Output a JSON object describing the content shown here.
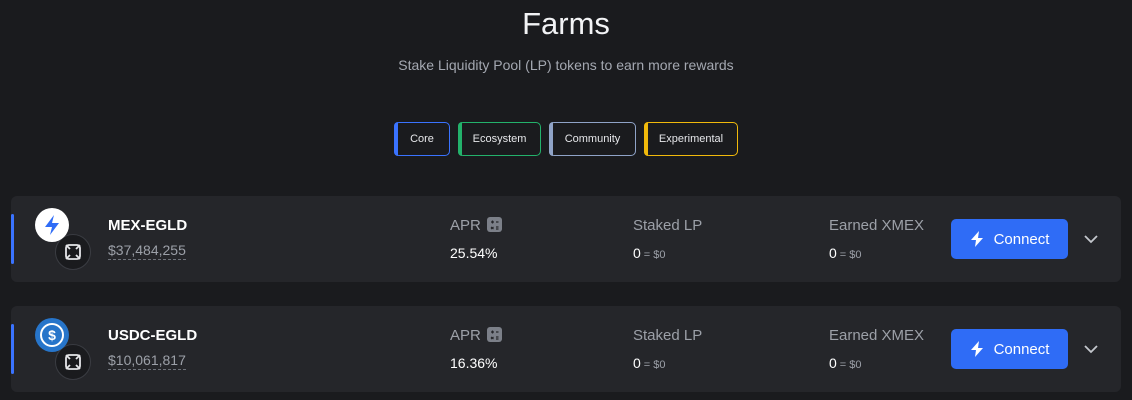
{
  "header": {
    "title": "Farms",
    "subtitle": "Stake Liquidity Pool (LP) tokens to earn more rewards"
  },
  "filters": [
    {
      "label": "Core",
      "color": "#3a73ff"
    },
    {
      "label": "Ecosystem",
      "color": "#23b26b"
    },
    {
      "label": "Community",
      "color": "#8fa3c7"
    },
    {
      "label": "Experimental",
      "color": "#f0b90b"
    }
  ],
  "farms": [
    {
      "pair": "MEX-EGLD",
      "tvl": "$37,484,255",
      "main_icon": "lightning-token-icon",
      "sub_icon": "egld-token-icon",
      "apr_label": "APR",
      "apr_value": "25.54%",
      "staked_label": "Staked LP",
      "staked_value": "0",
      "staked_usd": "= $0",
      "earned_label": "Earned XMEX",
      "earned_value": "0",
      "earned_usd": "= $0",
      "connect_label": "Connect"
    },
    {
      "pair": "USDC-EGLD",
      "tvl": "$10,061,817",
      "main_icon": "usdc-token-icon",
      "sub_icon": "egld-token-icon",
      "apr_label": "APR",
      "apr_value": "16.36%",
      "staked_label": "Staked LP",
      "staked_value": "0",
      "staked_usd": "= $0",
      "earned_label": "Earned XMEX",
      "earned_value": "0",
      "earned_usd": "= $0",
      "connect_label": "Connect"
    }
  ],
  "colors": {
    "background": "#1a1b1e",
    "card": "#25262a",
    "accent": "#2f6cf6",
    "usdc": "#2775ca"
  }
}
